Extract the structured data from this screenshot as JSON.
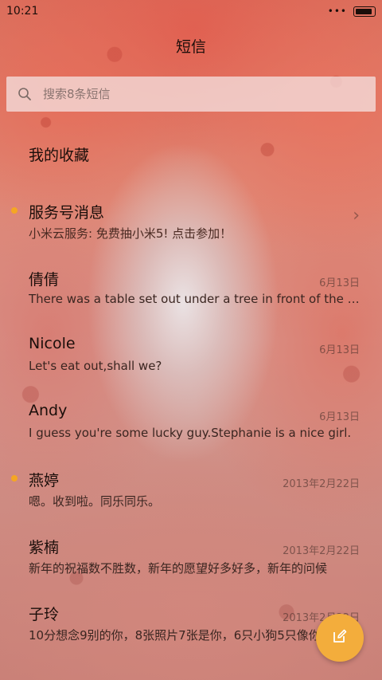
{
  "status_bar": {
    "time": "10:21",
    "signal": "•••"
  },
  "header": {
    "title": "短信"
  },
  "search": {
    "placeholder": "搜索8条短信",
    "icon": "search-icon"
  },
  "conversations": [
    {
      "name": "我的收藏",
      "preview": "",
      "date": "",
      "unread": false,
      "chevron": false
    },
    {
      "name": "服务号消息",
      "preview": "小米云服务: 免费抽小米5! 点击参加！",
      "date": "",
      "unread": true,
      "chevron": true
    },
    {
      "name": "倩倩",
      "preview": "There was a table set out under a tree in front of the house",
      "date": "6月13日",
      "unread": false
    },
    {
      "name": "Nicole",
      "preview": "Let's eat out,shall we?",
      "date": "6月13日",
      "unread": false
    },
    {
      "name": "Andy",
      "preview": "I guess you're some lucky guy.Stephanie is a nice girl.",
      "date": "6月13日",
      "unread": false
    },
    {
      "name": "燕婷",
      "preview": "嗯。收到啦。同乐同乐。",
      "date": "2013年2月22日",
      "unread": true
    },
    {
      "name": "紫楠",
      "preview": "新年的祝福数不胜数，新年的愿望好多好多，新年的问候",
      "date": "2013年2月22日",
      "unread": false
    },
    {
      "name": "子玲",
      "preview": "10分想念9别的你，8张照片7张是你，6只小狗5只像你",
      "date": "2013年2月22日",
      "unread": false
    }
  ],
  "fab": {
    "icon": "compose-icon",
    "color": "#f3ad3c"
  },
  "colors": {
    "unread_dot": "#f5a623",
    "accent": "#f3ad3c"
  }
}
